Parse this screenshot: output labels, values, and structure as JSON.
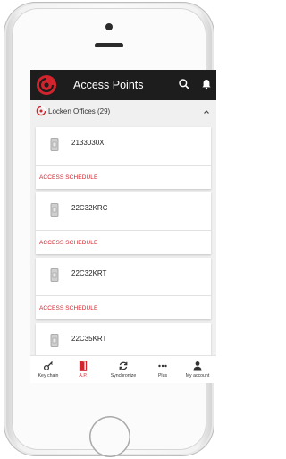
{
  "app": {
    "title": "Access Points"
  },
  "group": {
    "label": "Locken Offices (29)"
  },
  "items": [
    {
      "name": "2133030X",
      "action": "ACCESS SCHEDULE"
    },
    {
      "name": "22C32KRC",
      "action": "ACCESS SCHEDULE"
    },
    {
      "name": "22C32KRT",
      "action": "ACCESS SCHEDULE"
    },
    {
      "name": "22C35KRT",
      "action": ""
    }
  ],
  "nav": [
    {
      "label": "Key chain",
      "icon": "key-icon"
    },
    {
      "label": "A.P.",
      "icon": "door-icon",
      "active": true
    },
    {
      "label": "Synchronize",
      "icon": "sync-icon"
    },
    {
      "label": "Plus",
      "icon": "more-icon"
    },
    {
      "label": "My account",
      "icon": "person-icon"
    }
  ],
  "colors": {
    "appbar": "#1d1d1d",
    "accent": "#d3242e",
    "background": "#f0f0f0"
  }
}
